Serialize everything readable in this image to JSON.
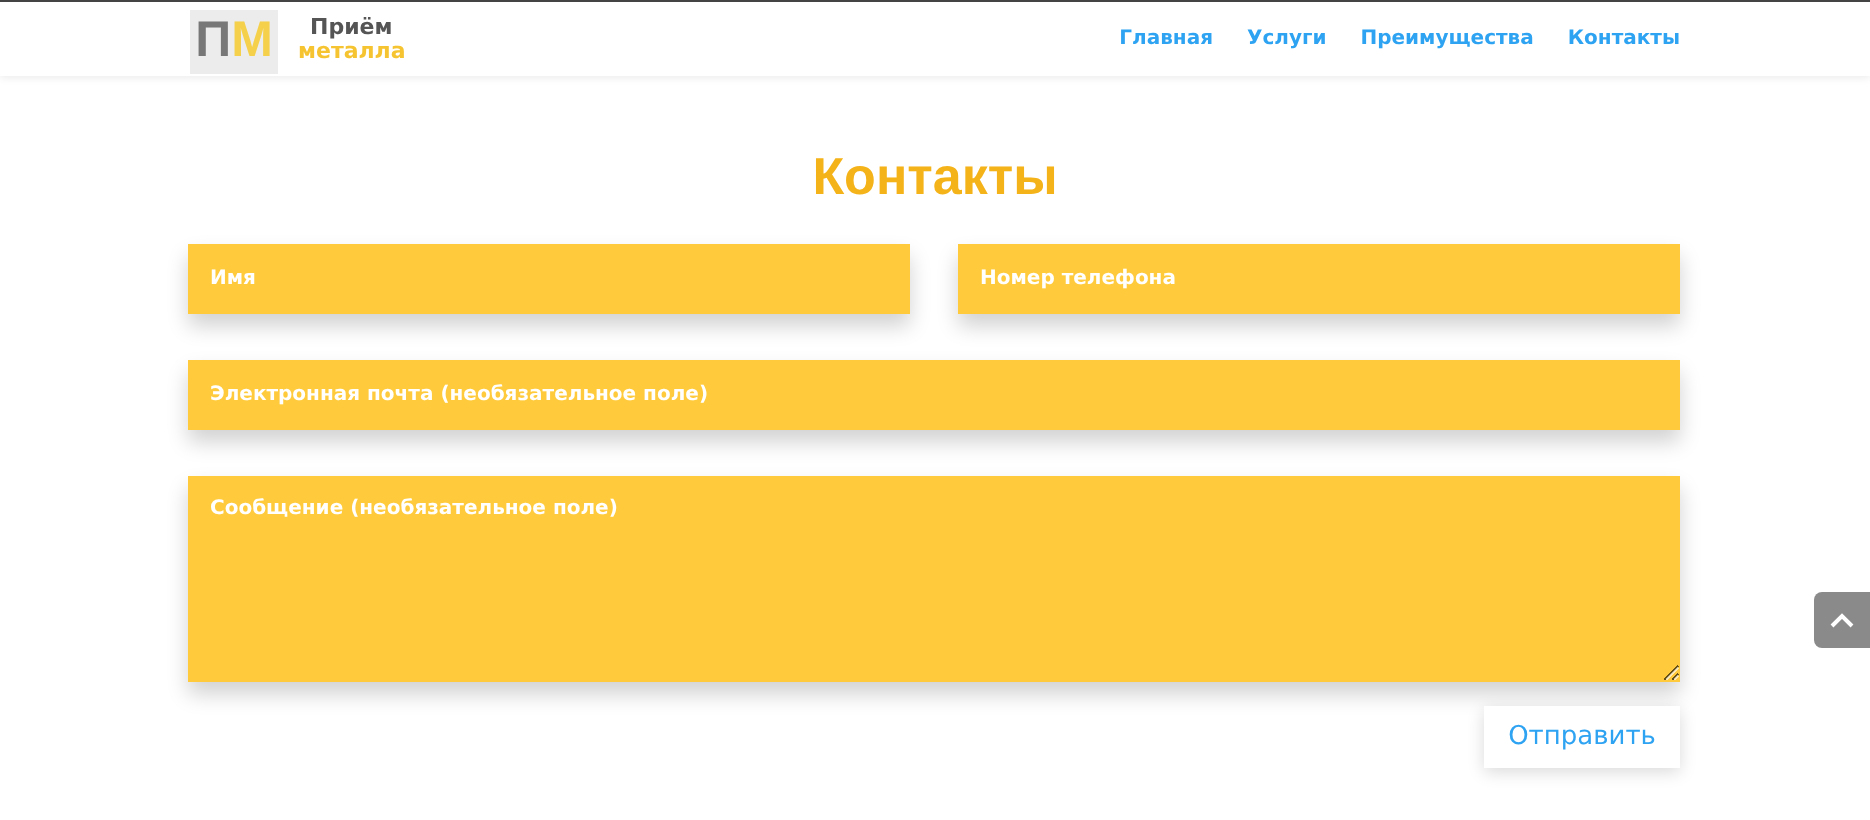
{
  "logo": {
    "mark_left": "П",
    "mark_right": "М",
    "line1": "Приём",
    "line2": "металла"
  },
  "nav": [
    {
      "label": "Главная"
    },
    {
      "label": "Услуги"
    },
    {
      "label": "Преимущества"
    },
    {
      "label": "Контакты"
    }
  ],
  "heading": "Контакты",
  "form": {
    "name": {
      "placeholder": "Имя"
    },
    "phone": {
      "placeholder": "Номер телефона"
    },
    "email": {
      "placeholder": "Электронная почта (необязательное поле)"
    },
    "message": {
      "placeholder": "Сообщение (необязательное поле)"
    },
    "submit": "Отправить"
  }
}
